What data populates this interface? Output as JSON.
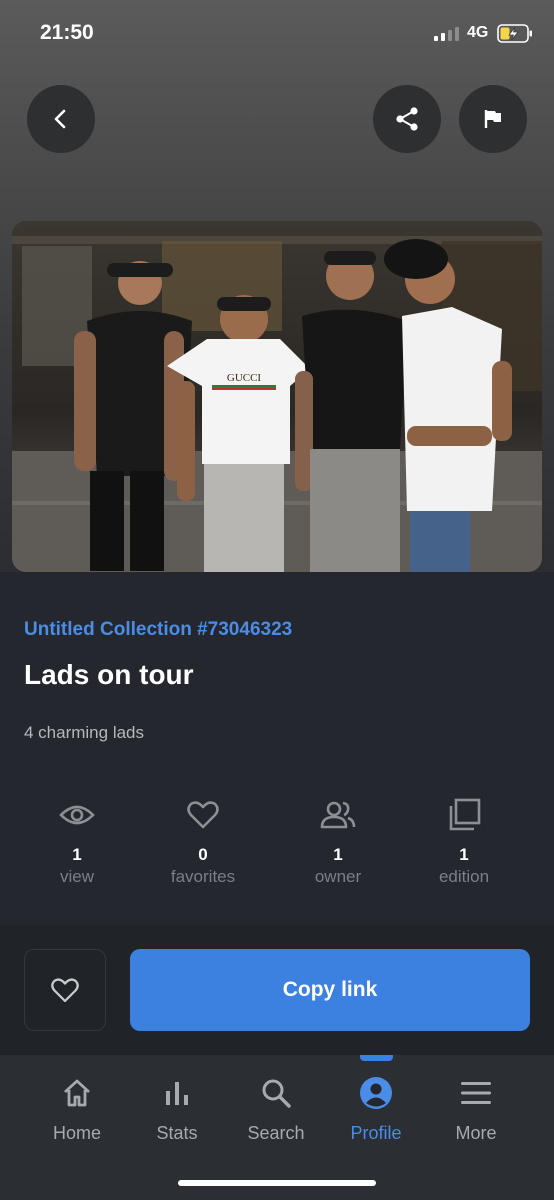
{
  "status_bar": {
    "time": "21:50",
    "network": "4G"
  },
  "header": {
    "back_icon": "chevron-left-icon",
    "share_icon": "share-icon",
    "flag_icon": "flag-icon"
  },
  "nft": {
    "image_alt": "photo-of-four-lads",
    "shirt_text": "GUCCI",
    "collection": "Untitled Collection #73046323",
    "title": "Lads on tour",
    "description": "4 charming lads"
  },
  "stats": [
    {
      "icon": "eye-icon",
      "value": "1",
      "label": "view"
    },
    {
      "icon": "heart-icon",
      "value": "0",
      "label": "favorites"
    },
    {
      "icon": "users-icon",
      "value": "1",
      "label": "owner"
    },
    {
      "icon": "copies-icon",
      "value": "1",
      "label": "edition"
    }
  ],
  "actions": {
    "copy_label": "Copy link",
    "favorite_icon": "heart-icon"
  },
  "tabs": [
    {
      "icon": "home-icon",
      "label": "Home",
      "active": false
    },
    {
      "icon": "bar-chart-icon",
      "label": "Stats",
      "active": false
    },
    {
      "icon": "search-icon",
      "label": "Search",
      "active": false
    },
    {
      "icon": "profile-icon",
      "label": "Profile",
      "active": true
    },
    {
      "icon": "menu-icon",
      "label": "More",
      "active": false
    }
  ],
  "colors": {
    "accent": "#3c80e0",
    "link": "#4a8ce6",
    "background": "#24272d"
  }
}
